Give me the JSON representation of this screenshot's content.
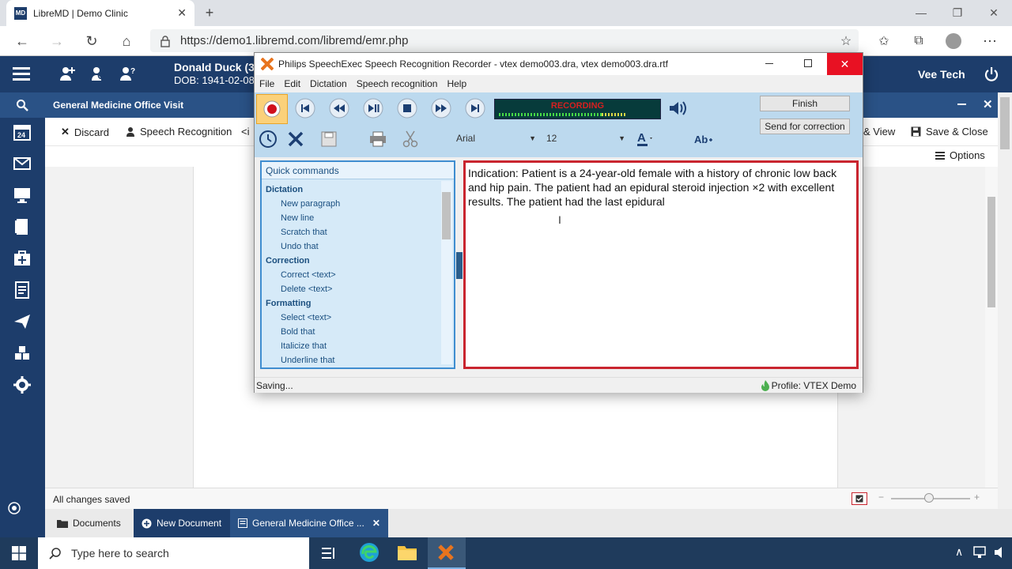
{
  "browser": {
    "tab_title": "LibreMD | Demo Clinic",
    "favicon_text": "MD",
    "url": "https://demo1.libremd.com/libremd/emr.php"
  },
  "emr": {
    "patient_name": "Donald Duck (3)",
    "patient_dob": "DOB: 1941-02-08",
    "user_name": "Vee Tech",
    "visit_title": "General Medicine Office Visit",
    "toolbar": {
      "discard": "Discard",
      "speech_recognition": "Speech Recognition",
      "insert_partial": "<i",
      "save_view_partial": "& View",
      "save_close": "Save & Close"
    },
    "options_label": "Options",
    "status_text": "All changes saved",
    "bottom_tabs": {
      "documents": "Documents",
      "new_document": "New Document",
      "current_doc": "General Medicine Office ..."
    }
  },
  "dialog": {
    "title": "Philips SpeechExec Speech Recognition Recorder - vtex demo003.dra, vtex demo003.dra.rtf",
    "menu": [
      "File",
      "Edit",
      "Dictation",
      "Speech recognition",
      "Help"
    ],
    "recording_label": "RECORDING",
    "finish_label": "Finish",
    "send_correction_label": "Send for correction",
    "font_name": "Arial",
    "font_size": "12",
    "quick_commands_header": "Quick commands",
    "quick_commands": {
      "dictation_header": "Dictation",
      "dictation_items": [
        "New paragraph",
        "New line",
        "Scratch that",
        "Undo that"
      ],
      "correction_header": "Correction",
      "correction_items": [
        "Correct <text>",
        "Delete <text>"
      ],
      "formatting_header": "Formatting",
      "formatting_items": [
        "Select <text>",
        "Bold that",
        "Italicize that",
        "Underline that"
      ]
    },
    "editor_text": "Indication: Patient is a 24-year-old female with a history of chronic low back and hip pain.  The patient had an epidural steroid injection ×2 with excellent results.  The patient had the last epidural",
    "status_left": "Saving...",
    "status_profile": "Profile: VTEX Demo"
  },
  "taskbar": {
    "search_placeholder": "Type here to search"
  },
  "colors": {
    "emr_navy": "#1d3d6b",
    "recording_red": "#c9252f",
    "panel_blue": "#bcd9ee"
  }
}
